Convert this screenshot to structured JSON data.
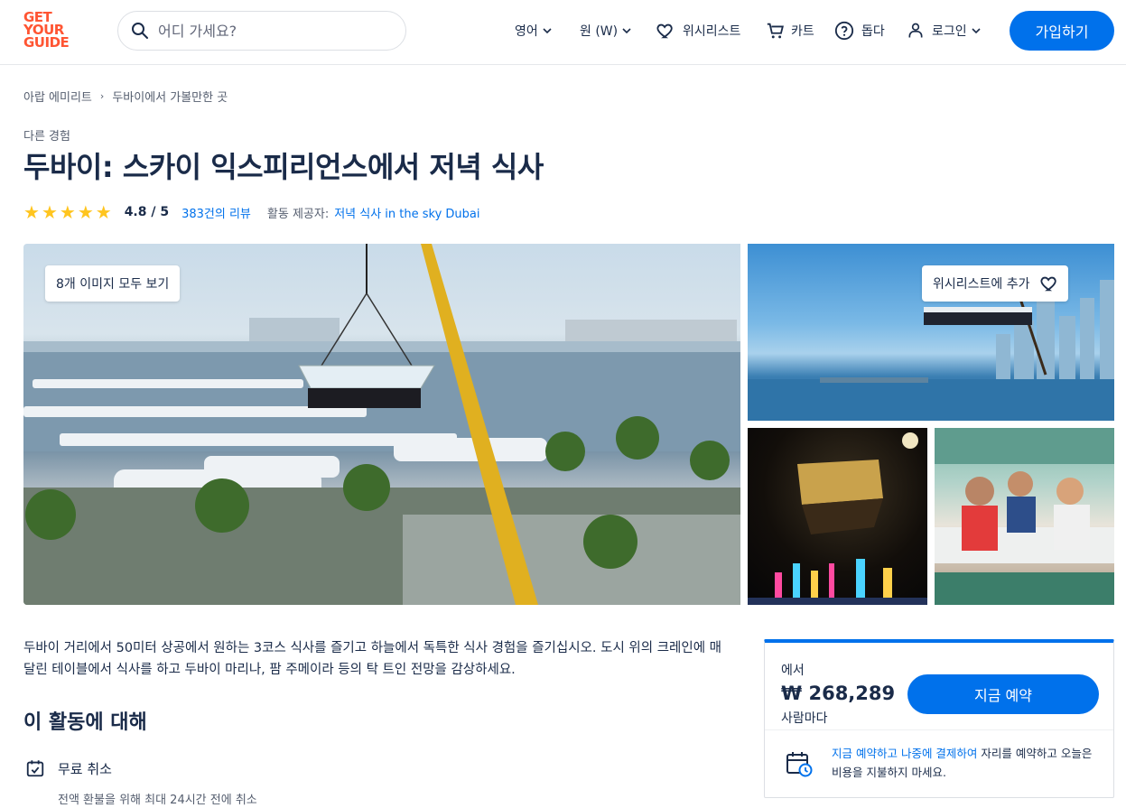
{
  "header": {
    "logo_lines": [
      "GET",
      "YOUR",
      "GUIDE"
    ],
    "search_placeholder": "어디 가세요?",
    "language": "영어",
    "currency": "원 (W)",
    "wishlist": "위시리스트",
    "cart": "카트",
    "help": "돕다",
    "login": "로그인",
    "signup": "가입하기"
  },
  "breadcrumb": [
    "아랍 에미리트",
    "두바이에서 가볼만한 곳"
  ],
  "breadcrumb_sep": "›",
  "category": "다른 경험",
  "title": "두바이: 스카이 익스피리언스에서 저녁 식사",
  "rating": {
    "stars": 5,
    "value": "4.8 / 5",
    "reviews": "383건의 리뷰",
    "provider_label": "활동 제공자:",
    "provider": "저녁 식사 in the sky Dubai"
  },
  "gallery": {
    "view_all": "8개 이미지 모두 보기",
    "add_wishlist": "위시리스트에 추가"
  },
  "description": "두바이 거리에서 50미터 상공에서 원하는 3코스 식사를 즐기고 하늘에서 독특한 식사 경험을 즐기십시오. 도시 위의 크레인에 매달린 테이블에서 식사를 하고 두바이 마리나, 팜 주메이라 등의 탁 트인 전망을 감상하세요.",
  "about": {
    "heading": "이 활동에 대해",
    "free_cancel": "무료 취소",
    "free_cancel_sub": "전액 환불을 위해 최대 24시간 전에 취소"
  },
  "booking": {
    "from": "에서",
    "price": "₩ 268,289",
    "per": "사람마다",
    "book_now": "지금 예약",
    "note_highlight": "지금 예약하고 나중에 결제하여",
    "note_rest": " 자리를 예약하고 오늘은 비용을 지불하지 마세요."
  },
  "colors": {
    "brand": "#ff5533",
    "primary": "#0071eb",
    "text": "#1a2b49",
    "star": "#ffc51f"
  }
}
